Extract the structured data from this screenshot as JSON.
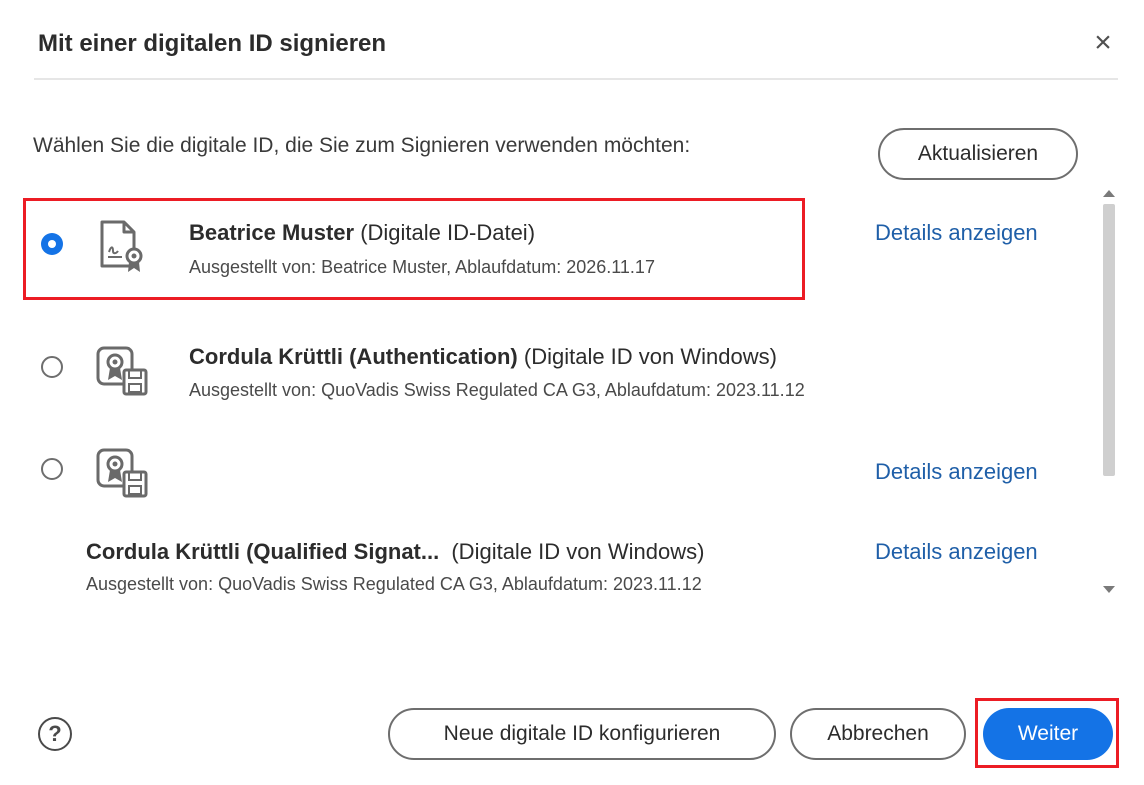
{
  "dialog": {
    "title": "Mit einer digitalen ID signieren",
    "close_symbol": "×",
    "prompt": "Wählen Sie die digitale ID, die Sie zum Signieren verwenden möchten:",
    "refresh_label": "Aktualisieren"
  },
  "ids": [
    {
      "name": "Beatrice Muster",
      "type": "(Digitale ID-Datei)",
      "issued": "Ausgestellt von: Beatrice Muster, Ablaufdatum: 2026.11.17",
      "details_label": "Details anzeigen",
      "selected": true,
      "icon": "certificate-file-icon"
    },
    {
      "name": "Cordula Krüttli (Authentication)",
      "type": "(Digitale ID von Windows)",
      "issued": "Ausgestellt von: QuoVadis Swiss Regulated CA G3, Ablaufdatum: 2023.11.12",
      "selected": false,
      "icon": "windows-certificate-icon"
    },
    {
      "details_label": "Details anzeigen",
      "selected": false,
      "icon": "windows-certificate-icon"
    },
    {
      "name": "Cordula Krüttli (Qualified Signat...",
      "type": "(Digitale ID von Windows)",
      "issued": "Ausgestellt von: QuoVadis Swiss Regulated CA G3, Ablaufdatum: 2023.11.12",
      "details_label": "Details anzeigen"
    }
  ],
  "footer": {
    "help_symbol": "?",
    "new_id_label": "Neue digitale ID konfigurieren",
    "cancel_label": "Abbrechen",
    "continue_label": "Weiter"
  },
  "colors": {
    "accent": "#1473e6",
    "link": "#1f5fa8",
    "highlight": "#ec1c24"
  }
}
